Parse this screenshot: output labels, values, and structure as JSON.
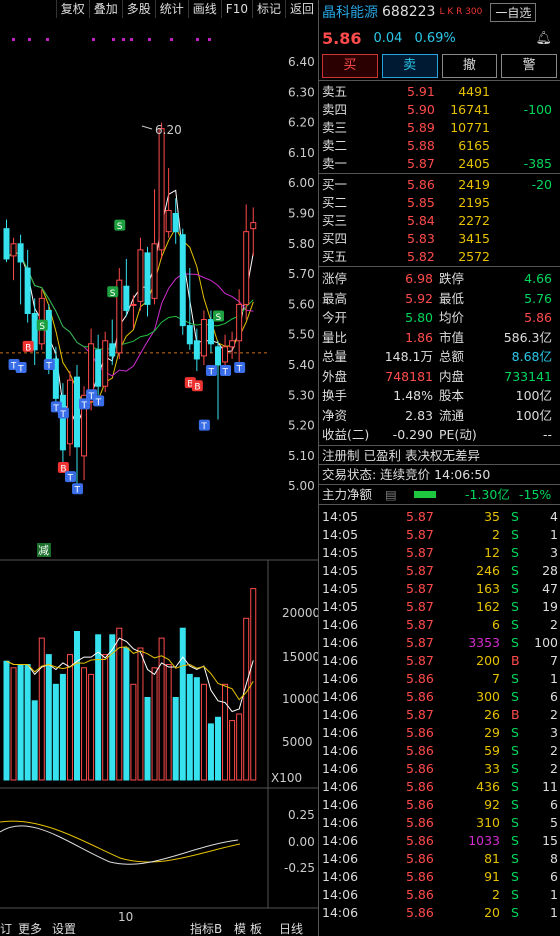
{
  "toolbar": [
    "复权",
    "叠加",
    "多股",
    "统计",
    "画线",
    "F10",
    "标记",
    "返回"
  ],
  "chart": {
    "yticks": [
      "6.40",
      "6.30",
      "6.20",
      "6.10",
      "6.00",
      "5.90",
      "5.80",
      "5.70",
      "5.60",
      "5.50",
      "5.40",
      "5.30",
      "5.20",
      "5.10",
      "5.00"
    ],
    "high_label": "6.20",
    "vol_ticks": [
      "20000",
      "15000",
      "10000",
      "5000"
    ],
    "vol_unit": "X100",
    "macd_ticks": [
      "0.25",
      "0.00",
      "-0.25"
    ],
    "date_label": "10",
    "reduce_tag": "减",
    "bottom_tabs": [
      "订",
      "更多",
      "设置",
      "指标B",
      "模",
      "板",
      "日线"
    ]
  },
  "quote": {
    "name": "晶科能源",
    "code": "688223",
    "tag": "L K R 300",
    "watch": "一自选",
    "price": "5.86",
    "change": "0.04",
    "pct": "0.69%",
    "buttons": [
      "买",
      "卖",
      "撤",
      "警"
    ]
  },
  "orderbook": {
    "asks": [
      {
        "label": "卖五",
        "price": "5.91",
        "vol": "4491",
        "delta": ""
      },
      {
        "label": "卖四",
        "price": "5.90",
        "vol": "16741",
        "delta": "-100"
      },
      {
        "label": "卖三",
        "price": "5.89",
        "vol": "10771",
        "delta": ""
      },
      {
        "label": "卖二",
        "price": "5.88",
        "vol": "6165",
        "delta": ""
      },
      {
        "label": "卖一",
        "price": "5.87",
        "vol": "2405",
        "delta": "-385"
      }
    ],
    "bids": [
      {
        "label": "买一",
        "price": "5.86",
        "vol": "2419",
        "delta": "-20"
      },
      {
        "label": "买二",
        "price": "5.85",
        "vol": "2195",
        "delta": ""
      },
      {
        "label": "买三",
        "price": "5.84",
        "vol": "2272",
        "delta": ""
      },
      {
        "label": "买四",
        "price": "5.83",
        "vol": "3415",
        "delta": ""
      },
      {
        "label": "买五",
        "price": "5.82",
        "vol": "2572",
        "delta": ""
      }
    ]
  },
  "stats": [
    {
      "l1": "涨停",
      "v1": "6.98",
      "c1": "r",
      "l2": "跌停",
      "v2": "4.66",
      "c2": "g"
    },
    {
      "l1": "最高",
      "v1": "5.92",
      "c1": "r",
      "l2": "最低",
      "v2": "5.76",
      "c2": "g"
    },
    {
      "l1": "今开",
      "v1": "5.80",
      "c1": "g",
      "l2": "均价",
      "v2": "5.86",
      "c2": "r"
    },
    {
      "l1": "量比",
      "v1": "1.86",
      "c1": "r",
      "l2": "市值",
      "v2": "586.3亿",
      "c2": "w"
    },
    {
      "l1": "总量",
      "v1": "148.1万",
      "c1": "w",
      "l2": "总额",
      "v2": "8.68亿",
      "c2": "c"
    },
    {
      "l1": "外盘",
      "v1": "748181",
      "c1": "r",
      "l2": "内盘",
      "v2": "733141",
      "c2": "g"
    },
    {
      "l1": "换手",
      "v1": "1.48%",
      "c1": "w",
      "l2": "股本",
      "v2": "100亿",
      "c2": "w"
    },
    {
      "l1": "净资",
      "v1": "2.83",
      "c1": "w",
      "l2": "流通",
      "v2": "100亿",
      "c2": "w"
    },
    {
      "l1": "收益(二)",
      "v1": "-0.290",
      "c1": "w",
      "l2": "PE(动)",
      "v2": "--",
      "c2": "w"
    }
  ],
  "info": {
    "line1": "注册制 已盈利 表决权无差异",
    "line2": "交易状态: 连续竞价 14:06:50",
    "flow_label": "主力净额",
    "flow_value": "-1.30亿",
    "flow_pct": "-15%"
  },
  "ticks": [
    {
      "t": "14:05",
      "p": "5.87",
      "v": "35",
      "vc": "y",
      "d": "S",
      "n": "4"
    },
    {
      "t": "14:05",
      "p": "5.87",
      "v": "2",
      "vc": "y",
      "d": "S",
      "n": "1"
    },
    {
      "t": "14:05",
      "p": "5.87",
      "v": "12",
      "vc": "y",
      "d": "S",
      "n": "3"
    },
    {
      "t": "14:05",
      "p": "5.87",
      "v": "246",
      "vc": "y",
      "d": "S",
      "n": "28"
    },
    {
      "t": "14:05",
      "p": "5.87",
      "v": "163",
      "vc": "y",
      "d": "S",
      "n": "47"
    },
    {
      "t": "14:05",
      "p": "5.87",
      "v": "162",
      "vc": "y",
      "d": "S",
      "n": "19"
    },
    {
      "t": "14:06",
      "p": "5.87",
      "v": "6",
      "vc": "y",
      "d": "S",
      "n": "2"
    },
    {
      "t": "14:06",
      "p": "5.87",
      "v": "3353",
      "vc": "m",
      "d": "S",
      "n": "100"
    },
    {
      "t": "14:06",
      "p": "5.87",
      "v": "200",
      "vc": "y",
      "d": "B",
      "n": "7"
    },
    {
      "t": "14:06",
      "p": "5.86",
      "v": "7",
      "vc": "y",
      "d": "S",
      "n": "1"
    },
    {
      "t": "14:06",
      "p": "5.86",
      "v": "300",
      "vc": "y",
      "d": "S",
      "n": "6"
    },
    {
      "t": "14:06",
      "p": "5.87",
      "v": "26",
      "vc": "y",
      "d": "B",
      "n": "2"
    },
    {
      "t": "14:06",
      "p": "5.86",
      "v": "29",
      "vc": "y",
      "d": "S",
      "n": "3"
    },
    {
      "t": "14:06",
      "p": "5.86",
      "v": "59",
      "vc": "y",
      "d": "S",
      "n": "2"
    },
    {
      "t": "14:06",
      "p": "5.86",
      "v": "33",
      "vc": "y",
      "d": "S",
      "n": "2"
    },
    {
      "t": "14:06",
      "p": "5.86",
      "v": "436",
      "vc": "y",
      "d": "S",
      "n": "11"
    },
    {
      "t": "14:06",
      "p": "5.86",
      "v": "92",
      "vc": "y",
      "d": "S",
      "n": "6"
    },
    {
      "t": "14:06",
      "p": "5.86",
      "v": "310",
      "vc": "y",
      "d": "S",
      "n": "5"
    },
    {
      "t": "14:06",
      "p": "5.86",
      "v": "1033",
      "vc": "m",
      "d": "S",
      "n": "15"
    },
    {
      "t": "14:06",
      "p": "5.86",
      "v": "81",
      "vc": "y",
      "d": "S",
      "n": "8"
    },
    {
      "t": "14:06",
      "p": "5.86",
      "v": "91",
      "vc": "y",
      "d": "S",
      "n": "6"
    },
    {
      "t": "14:06",
      "p": "5.86",
      "v": "2",
      "vc": "y",
      "d": "S",
      "n": "1"
    },
    {
      "t": "14:06",
      "p": "5.86",
      "v": "20",
      "vc": "y",
      "d": "S",
      "n": "1"
    }
  ],
  "candles": [
    [
      5.85,
      5.75,
      5.88,
      5.74
    ],
    [
      5.76,
      5.8,
      5.82,
      5.68
    ],
    [
      5.8,
      5.74,
      5.83,
      5.6
    ],
    [
      5.72,
      5.57,
      5.78,
      5.54
    ],
    [
      5.57,
      5.45,
      5.62,
      5.4
    ],
    [
      5.47,
      5.62,
      5.65,
      5.45
    ],
    [
      5.58,
      5.4,
      5.6,
      5.37
    ],
    [
      5.42,
      5.29,
      5.46,
      5.26
    ],
    [
      5.3,
      5.12,
      5.34,
      5.08
    ],
    [
      5.14,
      5.35,
      5.38,
      5.1
    ],
    [
      5.36,
      5.13,
      5.4,
      4.99
    ],
    [
      5.1,
      5.3,
      5.33,
      5.02
    ],
    [
      5.28,
      5.47,
      5.52,
      5.25
    ],
    [
      5.45,
      5.33,
      5.5,
      5.3
    ],
    [
      5.33,
      5.48,
      5.51,
      5.31
    ],
    [
      5.47,
      5.43,
      5.55,
      5.4
    ],
    [
      5.44,
      5.68,
      5.72,
      5.42
    ],
    [
      5.66,
      5.58,
      5.75,
      5.56
    ],
    [
      5.6,
      5.6,
      5.63,
      5.52
    ],
    [
      5.61,
      5.78,
      5.82,
      5.58
    ],
    [
      5.77,
      5.6,
      5.79,
      5.56
    ],
    [
      5.62,
      5.8,
      5.98,
      5.6
    ],
    [
      5.78,
      6.18,
      6.2,
      5.75
    ],
    [
      5.84,
      5.91,
      6.05,
      5.82
    ],
    [
      5.9,
      5.84,
      5.95,
      5.8
    ],
    [
      5.83,
      5.53,
      5.85,
      5.5
    ],
    [
      5.53,
      5.47,
      5.72,
      5.45
    ],
    [
      5.48,
      5.42,
      5.52,
      5.38
    ],
    [
      5.43,
      5.55,
      5.58,
      5.4
    ],
    [
      5.55,
      5.47,
      5.58,
      5.44
    ],
    [
      5.46,
      5.4,
      5.48,
      5.22
    ],
    [
      5.41,
      5.46,
      5.5,
      5.37
    ],
    [
      5.46,
      5.48,
      5.51,
      5.42
    ],
    [
      5.48,
      5.6,
      5.65,
      5.4
    ],
    [
      5.6,
      5.84,
      5.93,
      5.55
    ],
    [
      5.85,
      5.87,
      5.92,
      5.76
    ]
  ],
  "volumes": [
    180,
    170,
    175,
    175,
    120,
    215,
    190,
    145,
    160,
    190,
    225,
    170,
    160,
    220,
    190,
    220,
    230,
    200,
    145,
    200,
    125,
    170,
    215,
    175,
    125,
    230,
    160,
    155,
    145,
    85,
    95,
    145,
    90,
    100,
    245,
    290
  ],
  "colors": {
    "up": "#ff4b4b",
    "down": "#36e2ee",
    "ma5": "#ffffff",
    "ma10": "#e6c200",
    "ma20": "#d02cd0",
    "ma60": "#20c040",
    "panel_bg": "#000000",
    "grid": "#2a0c0c",
    "accent": "#27a3e0"
  }
}
